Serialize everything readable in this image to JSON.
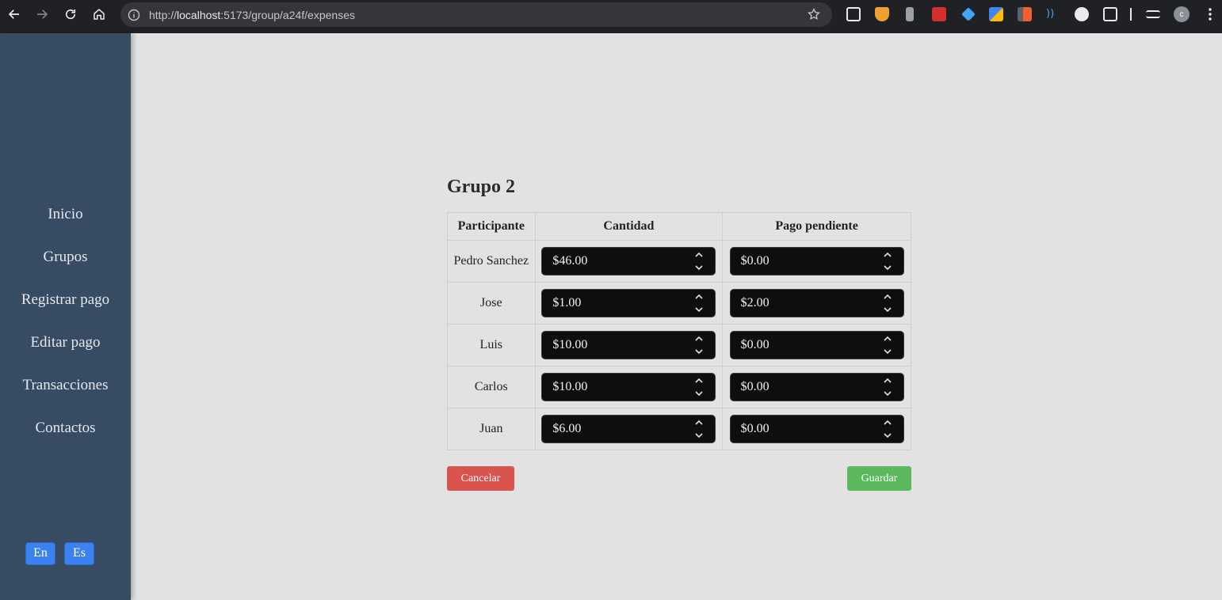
{
  "browser": {
    "url_prefix": "http://",
    "url_host": "localhost",
    "url_rest": ":5173/group/a24f/expenses",
    "profile_initial": "c"
  },
  "sidebar": {
    "items": [
      {
        "label": "Inicio"
      },
      {
        "label": "Grupos"
      },
      {
        "label": "Registrar pago"
      },
      {
        "label": "Editar pago"
      },
      {
        "label": "Transacciones"
      },
      {
        "label": "Contactos"
      }
    ],
    "lang_en": "En",
    "lang_es": "Es"
  },
  "main": {
    "title": "Grupo 2",
    "headers": [
      "Participante",
      "Cantidad",
      "Pago pendiente"
    ],
    "rows": [
      {
        "participant": "Pedro Sanchez",
        "amount": "$46.00",
        "pending": "$0.00"
      },
      {
        "participant": "Jose",
        "amount": "$1.00",
        "pending": "$2.00"
      },
      {
        "participant": "Luis",
        "amount": "$10.00",
        "pending": "$0.00"
      },
      {
        "participant": "Carlos",
        "amount": "$10.00",
        "pending": "$0.00"
      },
      {
        "participant": "Juan",
        "amount": "$6.00",
        "pending": "$0.00"
      }
    ],
    "cancel_label": "Cancelar",
    "save_label": "Guardar"
  }
}
